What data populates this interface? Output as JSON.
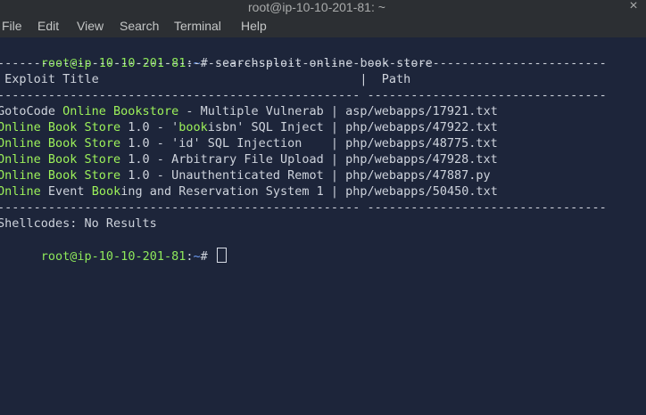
{
  "window": {
    "title": "root@ip-10-10-201-81: ~",
    "close_symbol": "×"
  },
  "menu": {
    "items": [
      "File",
      "Edit",
      "View",
      "Search",
      "Terminal",
      "Help"
    ]
  },
  "terminal": {
    "prompt_user": "root@ip-10-10-201-81",
    "prompt_sep": ":",
    "prompt_path": "~",
    "prompt_suffix": "# ",
    "command": "searchsploit online book store",
    "separator": "-------------------------------------------------- ---------------------------------",
    "header": " Exploit Title                                    |  Path",
    "rows": [
      {
        "parts": [
          {
            "t": "GotoCode ",
            "hl": false
          },
          {
            "t": "Online Bookstore",
            "hl": true
          },
          {
            "t": " - Multiple Vulnerab | asp/webapps/17921.txt",
            "hl": false
          }
        ]
      },
      {
        "parts": [
          {
            "t": "Online Book Store",
            "hl": true
          },
          {
            "t": " 1.0 - '",
            "hl": false
          },
          {
            "t": "book",
            "hl": true
          },
          {
            "t": "isbn' SQL Inject | php/webapps/47922.txt",
            "hl": false
          }
        ]
      },
      {
        "parts": [
          {
            "t": "Online Book Store",
            "hl": true
          },
          {
            "t": " 1.0 - 'id' SQL Injection    | php/webapps/48775.txt",
            "hl": false
          }
        ]
      },
      {
        "parts": [
          {
            "t": "Online Book Store",
            "hl": true
          },
          {
            "t": " 1.0 - Arbitrary File Upload | php/webapps/47928.txt",
            "hl": false
          }
        ]
      },
      {
        "parts": [
          {
            "t": "Online Book Store",
            "hl": true
          },
          {
            "t": " 1.0 - Unauthenticated Remot | php/webapps/47887.py",
            "hl": false
          }
        ]
      },
      {
        "parts": [
          {
            "t": "Online",
            "hl": true
          },
          {
            "t": " Event ",
            "hl": false
          },
          {
            "t": "Book",
            "hl": true
          },
          {
            "t": "ing and Reservation System 1 | php/webapps/50450.txt",
            "hl": false
          }
        ]
      }
    ],
    "shellcodes": "Shellcodes: No Results"
  },
  "colors": {
    "background": "#1d253a",
    "prompt_user": "#8ee85b",
    "prompt_path": "#6c9cf5",
    "highlight": "#9df25a",
    "text": "#ced3dc",
    "chrome": "#2c2f33"
  }
}
